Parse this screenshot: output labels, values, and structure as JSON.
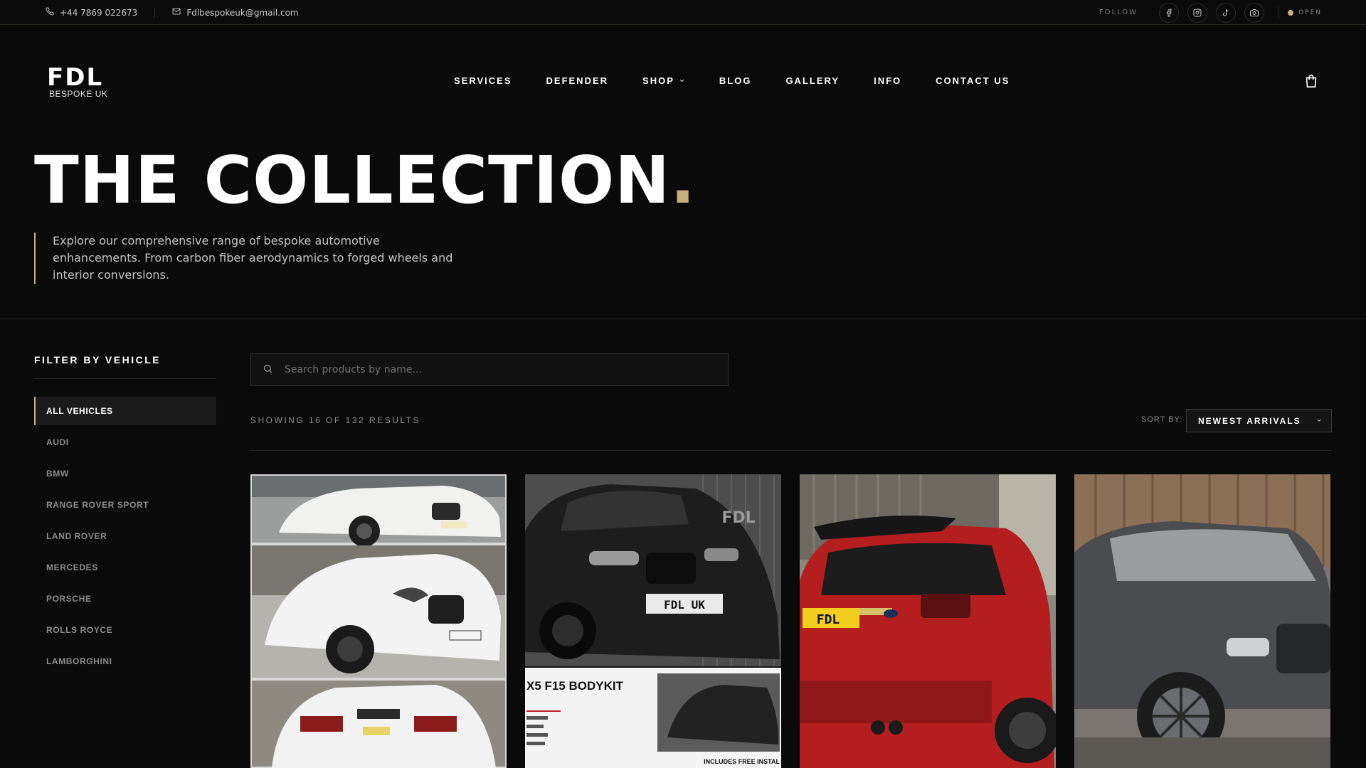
{
  "topbar": {
    "phone": "+44 7869 022673",
    "email": "Fdlbespokeuk@gmail.com",
    "follow_label": "FOLLOW",
    "socials": [
      "facebook-icon",
      "instagram-icon",
      "tiktok-icon",
      "camera-icon"
    ],
    "status": "OPEN"
  },
  "logo": {
    "main": "FDL",
    "sub": "BESPOKE UK"
  },
  "nav": {
    "items": [
      {
        "label": "SERVICES"
      },
      {
        "label": "DEFENDER"
      },
      {
        "label": "SHOP"
      },
      {
        "label": "BLOG"
      },
      {
        "label": "GALLERY"
      },
      {
        "label": "INFO"
      },
      {
        "label": "CONTACT US"
      }
    ]
  },
  "hero": {
    "title": "THE COLLECTION",
    "title_dot": ".",
    "description": "Explore our comprehensive range of bespoke automotive enhancements. From carbon fiber aerodynamics to forged wheels and interior conversions."
  },
  "filter": {
    "title": "FILTER BY VEHICLE",
    "items": [
      {
        "label": "ALL VEHICLES",
        "active": true
      },
      {
        "label": "AUDI"
      },
      {
        "label": "BMW"
      },
      {
        "label": "RANGE ROVER SPORT"
      },
      {
        "label": "LAND ROVER"
      },
      {
        "label": "MERCEDES"
      },
      {
        "label": "PORSCHE"
      },
      {
        "label": "ROLLS ROYCE"
      },
      {
        "label": "LAMBORGHINI"
      }
    ]
  },
  "search": {
    "placeholder": "Search products by name..."
  },
  "results": {
    "text": "SHOWING 16 OF 132 RESULTS"
  },
  "sort": {
    "label": "SORT BY:",
    "value": "NEWEST ARRIVALS"
  },
  "products": [
    {
      "image": "white-bmw-x5-collage"
    },
    {
      "image": "black-bmw-x5-bodykit",
      "overlay_title": "X5 F15 BODYKIT",
      "plate": "FDL UK",
      "watermark": "FDL",
      "footnote": "INCLUDES FREE INSTAL"
    },
    {
      "image": "red-range-rover-sport",
      "plate": "FDL"
    },
    {
      "image": "grey-bmw-x5"
    }
  ],
  "colors": {
    "accent": "#c7b07a",
    "background": "#0a0a0a"
  }
}
